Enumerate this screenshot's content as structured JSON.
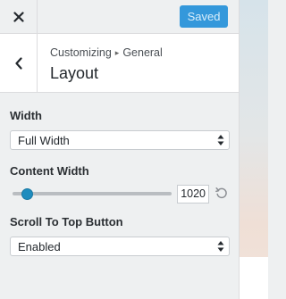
{
  "header": {
    "close_icon": "close-icon",
    "save_label": "Saved",
    "accent": "#3498db"
  },
  "section": {
    "back_icon": "chevron-left-icon",
    "breadcrumb_parent": "Customizing",
    "breadcrumb_separator": "▸",
    "breadcrumb_current": "General",
    "title": "Layout"
  },
  "controls": {
    "width": {
      "label": "Width",
      "value": "Full Width"
    },
    "content_width": {
      "label": "Content Width",
      "value": "1020",
      "slider_position": 0.09,
      "reset_icon": "undo-icon"
    },
    "scroll_to_top": {
      "label": "Scroll To Top Button",
      "value": "Enabled"
    }
  }
}
